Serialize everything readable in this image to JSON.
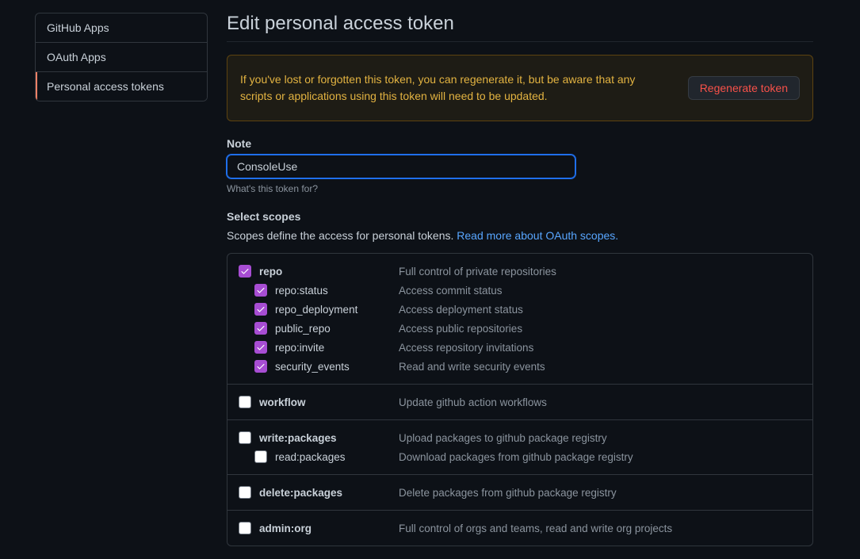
{
  "sidebar": {
    "items": [
      {
        "label": "GitHub Apps"
      },
      {
        "label": "OAuth Apps"
      },
      {
        "label": "Personal access tokens"
      }
    ]
  },
  "page": {
    "title": "Edit personal access token"
  },
  "flash": {
    "text": "If you've lost or forgotten this token, you can regenerate it, but be aware that any scripts or applications using this token will need to be updated.",
    "button": "Regenerate token"
  },
  "note": {
    "label": "Note",
    "value": "ConsoleUse",
    "hint": "What's this token for?"
  },
  "scopes": {
    "label": "Select scopes",
    "description_prefix": "Scopes define the access for personal tokens. ",
    "link_text": "Read more about OAuth scopes.",
    "groups": [
      {
        "name": "repo",
        "desc": "Full control of private repositories",
        "checked": true,
        "children": [
          {
            "name": "repo:status",
            "desc": "Access commit status",
            "checked": true
          },
          {
            "name": "repo_deployment",
            "desc": "Access deployment status",
            "checked": true
          },
          {
            "name": "public_repo",
            "desc": "Access public repositories",
            "checked": true
          },
          {
            "name": "repo:invite",
            "desc": "Access repository invitations",
            "checked": true
          },
          {
            "name": "security_events",
            "desc": "Read and write security events",
            "checked": true
          }
        ]
      },
      {
        "name": "workflow",
        "desc": "Update github action workflows",
        "checked": false,
        "children": []
      },
      {
        "name": "write:packages",
        "desc": "Upload packages to github package registry",
        "checked": false,
        "children": [
          {
            "name": "read:packages",
            "desc": "Download packages from github package registry",
            "checked": false
          }
        ]
      },
      {
        "name": "delete:packages",
        "desc": "Delete packages from github package registry",
        "checked": false,
        "children": []
      },
      {
        "name": "admin:org",
        "desc": "Full control of orgs and teams, read and write org projects",
        "checked": false,
        "children": []
      }
    ]
  }
}
